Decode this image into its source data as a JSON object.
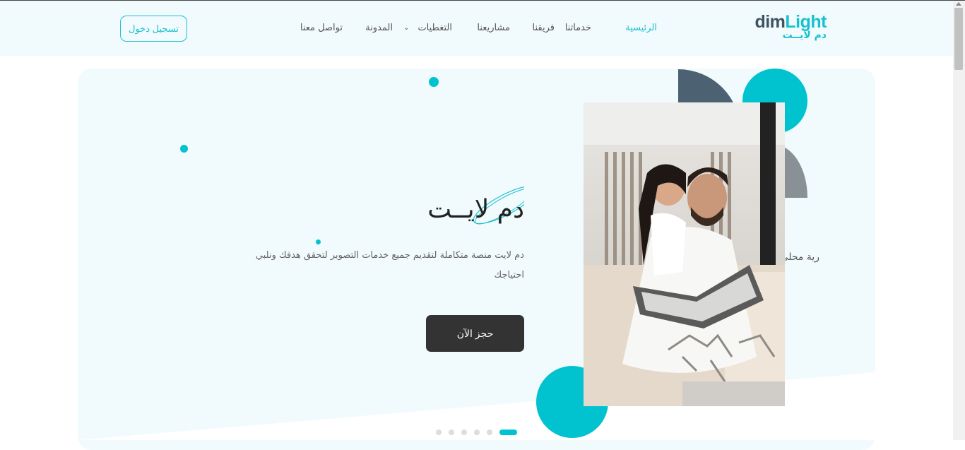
{
  "brand": {
    "name_en_part1": "dim",
    "name_en_part2": "Light",
    "name_ar": "دم لايــت"
  },
  "nav": {
    "items": [
      {
        "label": "الرئيسية",
        "active": true
      },
      {
        "label": "خدماتنا",
        "active": false
      },
      {
        "label": "فريقنا",
        "active": false
      },
      {
        "label": "مشاريعنا",
        "active": false
      },
      {
        "label": "التغطيات",
        "active": false,
        "has_dropdown": true
      },
      {
        "label": "المدونة",
        "active": false
      },
      {
        "label": "تواصل معنا",
        "active": false
      }
    ],
    "dropdown_icon": "chevron-down-icon"
  },
  "header": {
    "login_label": "تسجيل دخول"
  },
  "hero": {
    "title": "دم لايــت",
    "description": "دم لايت منصة متكاملة لتقديم جميع خدمات التصوير لتحقق هدفك ونلبي احتياجك",
    "cta_label": "حجز الآن",
    "next_slide_peek": "رية محلي",
    "slider": {
      "total": 5,
      "active_index": 0
    }
  },
  "colors": {
    "accent": "#00c3cf",
    "dark": "#333333",
    "header_bg": "#f1fafc",
    "slate": "#4c6272",
    "gray_shape": "#8a9196"
  }
}
